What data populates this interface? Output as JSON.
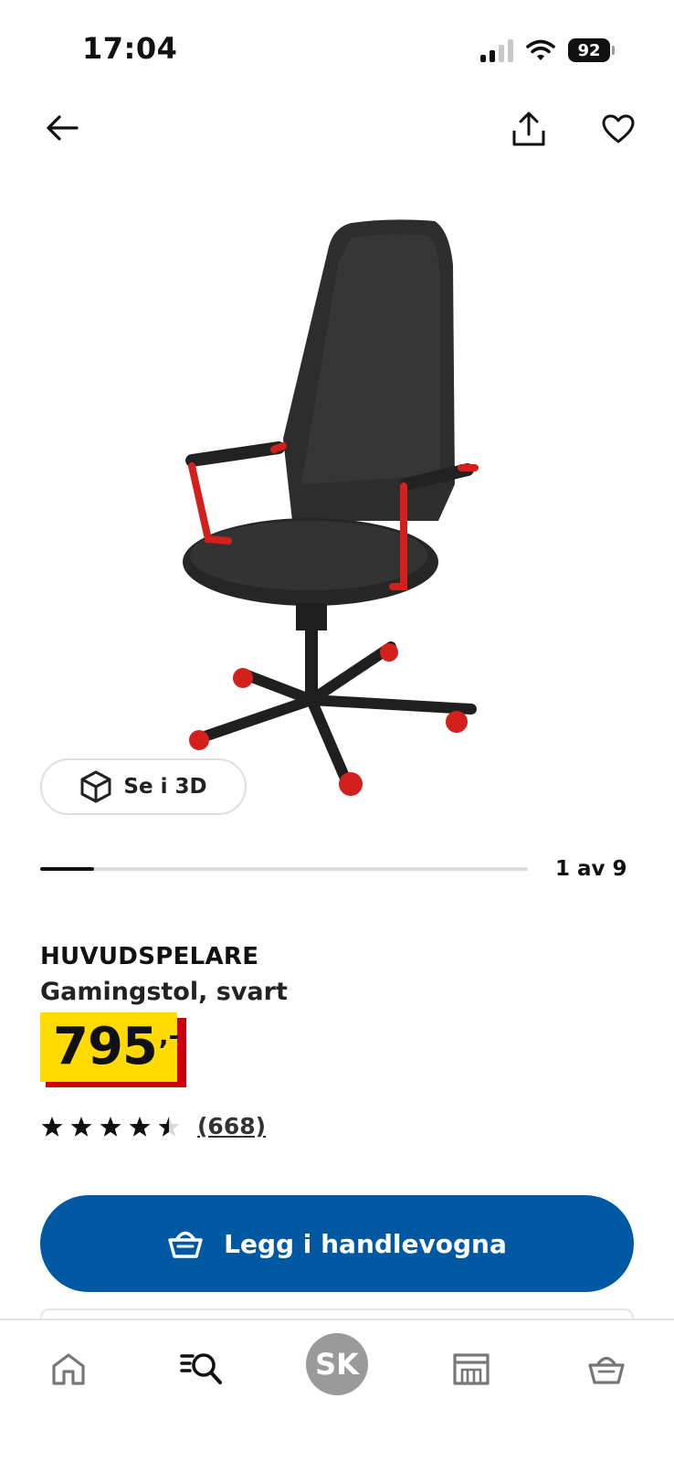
{
  "status_bar": {
    "time": "17:04",
    "battery": "92"
  },
  "top_nav": {
    "back_icon": "arrow-left-icon",
    "share_icon": "share-icon",
    "favorite_icon": "heart-icon"
  },
  "gallery": {
    "view_3d_label": "Se i 3D",
    "counter": "1 av 9",
    "progress": 0.11
  },
  "product": {
    "brand": "HUVUDSPELARE",
    "description": "Gamingstol, svart",
    "price": "795",
    "price_suffix": ",-",
    "rating": 4.5,
    "review_count": "(668)"
  },
  "cta": {
    "label": "Legg i handlevogna",
    "icon": "basket-icon"
  },
  "bottom_nav": {
    "items": [
      {
        "name": "home",
        "icon": "home-icon"
      },
      {
        "name": "search",
        "icon": "search-icon"
      },
      {
        "name": "profile",
        "initials": "SK"
      },
      {
        "name": "store",
        "icon": "store-icon"
      },
      {
        "name": "cart",
        "icon": "cart-icon"
      }
    ]
  },
  "colors": {
    "price_yellow": "#FFDB00",
    "price_red": "#CC0008",
    "cta_blue": "#0058A3"
  }
}
